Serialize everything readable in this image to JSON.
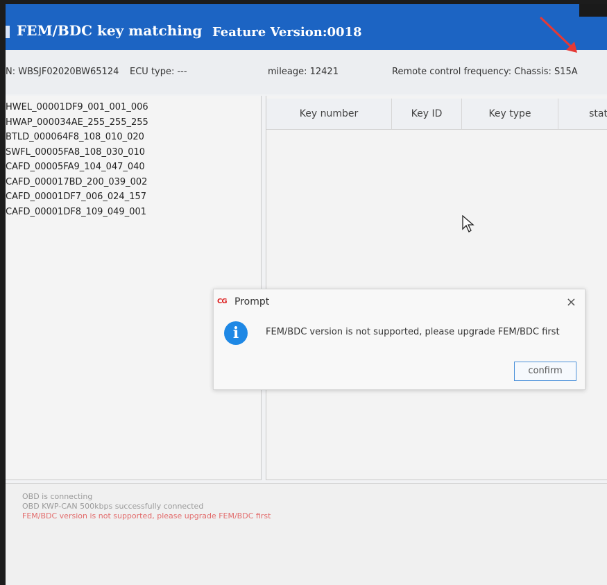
{
  "window": {
    "title": "FEM/BDC key matching",
    "feature_version": "Feature Version:0018"
  },
  "info": {
    "vin": "N: WBSJF02020BW65124",
    "ecu_type": "ECU type: ---",
    "mileage": "mileage: 12421",
    "remote_frequency": "Remote control frequency: Chassis: S15A"
  },
  "modules": [
    "HWEL_00001DF9_001_001_006",
    "HWAP_000034AE_255_255_255",
    "BTLD_000064F8_108_010_020",
    "SWFL_00005FA8_108_030_010",
    "CAFD_00005FA9_104_047_040",
    "CAFD_000017BD_200_039_002",
    "CAFD_00001DF7_006_024_157",
    "CAFD_00001DF8_109_049_001"
  ],
  "table": {
    "headers": [
      "Key number",
      "Key ID",
      "Key type",
      "stat"
    ]
  },
  "dialog": {
    "logo": "CG",
    "title": "Prompt",
    "close_glyph": "×",
    "icon": "info-icon",
    "icon_glyph": "i",
    "message": "FEM/BDC version is not supported, please upgrade FEM/BDC first",
    "confirm_label": "confirm"
  },
  "log": [
    {
      "text": "OBD is connecting",
      "color": "#9a9a9a"
    },
    {
      "text": "OBD KWP-CAN 500kbps successfully connected",
      "color": "#9a9a9a"
    },
    {
      "text": "FEM/BDC version is not supported, please upgrade FEM/BDC first",
      "color": "#e26b6b"
    }
  ],
  "colors": {
    "titlebar": "#1c64c3",
    "accent": "#1e88e5",
    "error": "#e26b6b",
    "annotation_arrow": "#e53935"
  }
}
